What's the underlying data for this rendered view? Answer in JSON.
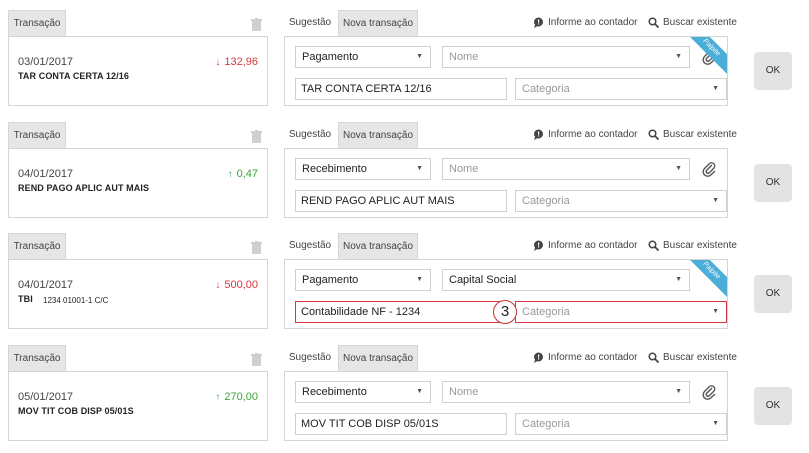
{
  "transactions": [
    {
      "tab_label": "Transação",
      "date": "03/01/2017",
      "description": "TAR CONTA CERTA 12/16",
      "extra": "",
      "amount": "132,96",
      "direction": "down",
      "sugestao_tab": "Sugestão",
      "nova_tab": "Nova transação",
      "informe_label": "Informe ao contador",
      "buscar_label": "Buscar existente",
      "type_select": "Pagamento",
      "name_value": "Nome",
      "name_filled": false,
      "desc_value": "TAR CONTA CERTA 12/16",
      "category_placeholder": "Categoria",
      "ribbon": "Palpite",
      "ok_label": "OK"
    },
    {
      "tab_label": "Transação",
      "date": "04/01/2017",
      "description": "REND PAGO APLIC AUT MAIS",
      "extra": "",
      "amount": "0,47",
      "direction": "up",
      "sugestao_tab": "Sugestão",
      "nova_tab": "Nova transação",
      "informe_label": "Informe ao contador",
      "buscar_label": "Buscar existente",
      "type_select": "Recebimento",
      "name_value": "Nome",
      "name_filled": false,
      "desc_value": "REND PAGO APLIC AUT MAIS",
      "category_placeholder": "Categoria",
      "ribbon": "",
      "ok_label": "OK"
    },
    {
      "tab_label": "Transação",
      "date": "04/01/2017",
      "description": "TBI",
      "extra": "1234 01001-1   C/C",
      "amount": "500,00",
      "direction": "down",
      "sugestao_tab": "Sugestão",
      "nova_tab": "Nova transação",
      "informe_label": "Informe ao contador",
      "buscar_label": "Buscar existente",
      "type_select": "Pagamento",
      "name_value": "Capital Social",
      "name_filled": true,
      "desc_value": "Contabilidade NF - 1234",
      "category_placeholder": "Categoria",
      "ribbon": "Palpite",
      "ok_label": "OK",
      "marker": "3"
    },
    {
      "tab_label": "Transação",
      "date": "05/01/2017",
      "description": "MOV TIT COB DISP 05/01S",
      "extra": "",
      "amount": "270,00",
      "direction": "up",
      "sugestao_tab": "Sugestão",
      "nova_tab": "Nova transação",
      "informe_label": "Informe ao contador",
      "buscar_label": "Buscar existente",
      "type_select": "Recebimento",
      "name_value": "Nome",
      "name_filled": false,
      "desc_value": "MOV TIT COB DISP 05/01S",
      "category_placeholder": "Categoria",
      "ribbon": "",
      "ok_label": "OK"
    }
  ],
  "colors": {
    "negative": "#d9373f",
    "positive": "#3aa53a",
    "ribbon": "#4aaed8",
    "error_border": "#d9373f"
  },
  "icons": {
    "trash": "trash-icon",
    "chat": "chat-bubble-icon",
    "search": "search-icon",
    "clip": "paperclip-icon",
    "down_arrow": "arrow-down-icon",
    "up_arrow": "arrow-up-icon",
    "caret": "caret-down-icon"
  }
}
